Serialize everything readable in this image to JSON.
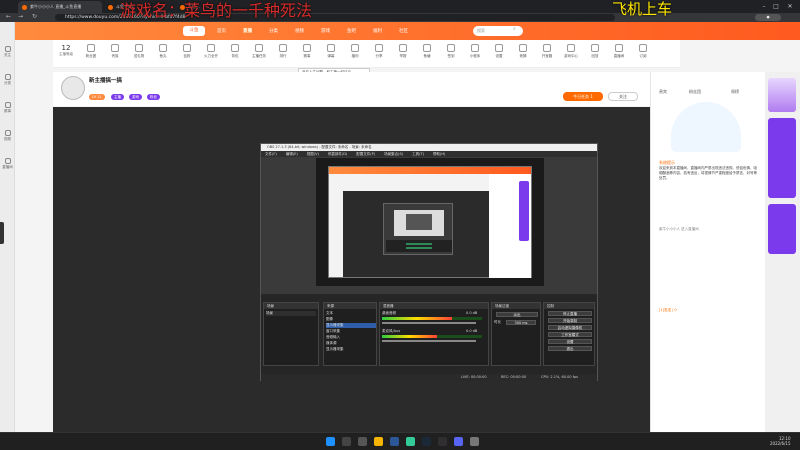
{
  "browser": {
    "tabs": [
      {
        "label": "紫牛小小小人 直播_斗鱼直播"
      },
      {
        "label": "斗鱼 Play"
      },
      {
        "label": "斗鱼..."
      }
    ],
    "url": "https://www.douyu.com/2537160?dyshid=0-bfa7f4d8"
  },
  "overlay": {
    "left_text": "游戏名：菜鸟的一千种死法",
    "right_text": "飞机上车"
  },
  "left_nav": [
    "关注",
    "分类",
    "赛事",
    "视频",
    "直播间"
  ],
  "site": {
    "logo": "斗鱼",
    "nav": [
      "首页",
      "直播",
      "分类",
      "视频",
      "游戏",
      "鱼吧",
      "福利",
      "社区"
    ],
    "search_placeholder": "搜索"
  },
  "toolbar": {
    "count": "12",
    "items": [
      "主播等级",
      "粉丝团",
      "贵族",
      "送礼物",
      "鱼丸",
      "钻粉",
      "火力全开",
      "背包",
      "主播任务",
      "排行",
      "赛事",
      "弹幕",
      "福利",
      "分享",
      "举报",
      "鱼塘",
      "签到",
      "小程序",
      "设置",
      "竞猜",
      "开宝箱",
      "游戏中心",
      "回放",
      "直播间",
      "订阅"
    ],
    "tooltip": "开启人生问题，和主播一起讨论..."
  },
  "streamer": {
    "title": "新主播搞一搞",
    "level": "LV 12",
    "tags": [
      "主播",
      "游戏",
      "粉丝"
    ],
    "follow": "关注",
    "subscribe": "今日任务 1"
  },
  "right_panel": {
    "tabs": [
      "贵宾",
      "粉丝团",
      "周榜"
    ],
    "notice_title": "系统提示",
    "notice": "欢迎来到本直播间，直播间内严禁出现违法违规、低俗色情、吸烟酗酒等内容，若有违反，将视情节严重程度给予禁言、封号等处罚。",
    "user_msg": "紫牛小小小人 进入直播间",
    "footer": "[1]发送 | 0"
  },
  "obs": {
    "title": "OBS 27.1.3 (64-bit, windows) - 配置文件: 未命名 - 场景: 未命名",
    "menu": [
      "文件(F)",
      "编辑(E)",
      "视图(V)",
      "停靠部件(D)",
      "配置文件(P)",
      "场景集合(S)",
      "工具(T)",
      "帮助(H)"
    ],
    "docks": {
      "scenes_title": "场景",
      "scene": "场景",
      "sources_title": "来源",
      "sources": [
        "文本",
        "图像",
        "显示器采集",
        "窗口采集",
        "音频输入",
        "媒体源",
        "显示器采集"
      ],
      "mixer_title": "混音器",
      "mixer": [
        {
          "name": "桌面音频",
          "value": "0.0 dB",
          "level": 0.7
        },
        {
          "name": "麦克风/Aux",
          "value": "0.0 dB",
          "level": 0.55
        }
      ],
      "transition_title": "场景过渡",
      "transition": "淡出",
      "duration_label": "时长",
      "duration": "300 ms",
      "controls_title": "控制",
      "controls": [
        "停止直播",
        "开始录制",
        "启动虚拟摄像机",
        "工作室模式",
        "设置",
        "退出"
      ]
    },
    "status": {
      "live": "LIVE: 00:00:00",
      "rec": "REC: 00:00:00",
      "cpu": "CPU: 2.1%, 60.00 fps"
    }
  },
  "taskbar": {
    "time": "12:10",
    "date": "2022/6/15"
  }
}
